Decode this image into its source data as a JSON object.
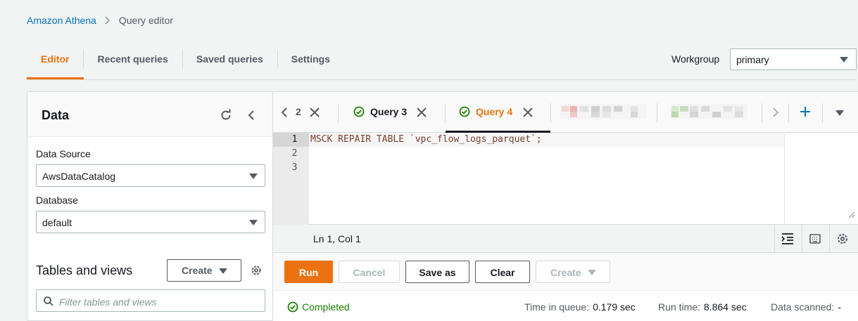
{
  "breadcrumb": {
    "service": "Amazon Athena",
    "page": "Query editor"
  },
  "tabs": [
    {
      "label": "Editor",
      "active": true
    },
    {
      "label": "Recent queries"
    },
    {
      "label": "Saved queries"
    },
    {
      "label": "Settings"
    }
  ],
  "workgroup": {
    "label": "Workgroup",
    "value": "primary"
  },
  "data_panel": {
    "title": "Data",
    "data_source_label": "Data Source",
    "data_source_value": "AwsDataCatalog",
    "database_label": "Database",
    "database_value": "default",
    "tables_title": "Tables and views",
    "create_label": "Create",
    "search_placeholder": "Filter tables and views"
  },
  "query_tabs": {
    "partial_label": "2",
    "items": [
      {
        "label": "Query 3",
        "status": "completed",
        "active": false
      },
      {
        "label": "Query 4",
        "status": "completed",
        "active": true
      }
    ]
  },
  "editor": {
    "line_numbers": [
      "1",
      "2",
      "3"
    ],
    "code": "MSCK REPAIR TABLE `vpc_flow_logs_parquet`;",
    "cursor_position": "Ln 1, Col 1"
  },
  "actions": {
    "run": "Run",
    "cancel": "Cancel",
    "save_as": "Save as",
    "clear": "Clear",
    "create": "Create"
  },
  "results": {
    "status": "Completed",
    "time_in_queue_label": "Time in queue:",
    "time_in_queue_value": "0.179 sec",
    "run_time_label": "Run time:",
    "run_time_value": "8.864 sec",
    "data_scanned_label": "Data scanned:",
    "data_scanned_value": "-"
  },
  "colors": {
    "accent": "#ec7211",
    "link": "#0073bb",
    "success": "#1d8102"
  }
}
